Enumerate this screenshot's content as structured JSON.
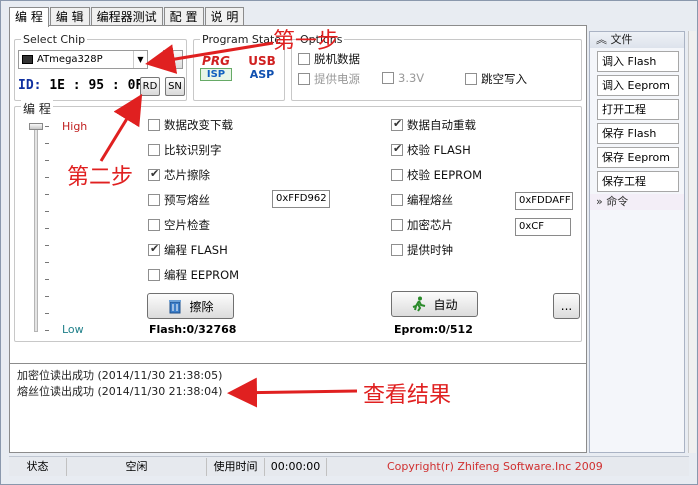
{
  "tabs": [
    "编 程",
    "编 辑",
    "编程器测试",
    "配 置",
    "说 明"
  ],
  "chip": {
    "group_title": "Select Chip",
    "selected": "ATmega328P",
    "id_label": "ID:",
    "id_value": "1E : 95 : 0F",
    "rd_label": "RD",
    "sn_label": "SN"
  },
  "program_state": {
    "group_title": "Program State",
    "prg": "PRG",
    "isp": "ISP",
    "usb": "USB",
    "asp": "ASP"
  },
  "options": {
    "group_title": "Options",
    "offline": "脱机数据",
    "power": "提供电源",
    "voltage": "3.3V",
    "skip": "跳空写入"
  },
  "program_group": {
    "title": "编 程",
    "high": "High",
    "low": "Low",
    "left_checks": [
      {
        "label": "数据改变下载",
        "checked": false
      },
      {
        "label": "比较识别字",
        "checked": false
      },
      {
        "label": "芯片擦除",
        "checked": true
      },
      {
        "label": "预写熔丝",
        "checked": false
      },
      {
        "label": "空片检查",
        "checked": false
      },
      {
        "label": "编程 FLASH",
        "checked": true
      },
      {
        "label": "编程 EEPROM",
        "checked": false
      }
    ],
    "right_checks": [
      {
        "label": "数据自动重载",
        "checked": true
      },
      {
        "label": "校验 FLASH",
        "checked": true
      },
      {
        "label": "校验 EEPROM",
        "checked": false
      },
      {
        "label": "编程熔丝",
        "checked": false
      },
      {
        "label": "加密芯片",
        "checked": false
      },
      {
        "label": "提供时钟",
        "checked": false
      }
    ],
    "prefuse_value": "0xFFD962",
    "fuse_value": "0xFDDAFF",
    "lock_value": "0xCF",
    "erase_button": "擦除",
    "auto_button": "自动",
    "more_button": "...",
    "flash_status": "Flash:0/32768",
    "eprom_status": "Eprom:0/512"
  },
  "log": [
    "加密位读出成功 (2014/11/30 21:38:05)",
    "熔丝位读出成功 (2014/11/30 21:38:04)"
  ],
  "right_panel": {
    "file_header": "文件",
    "buttons": [
      "调入 Flash",
      "调入 Eeprom",
      "打开工程",
      "保存 Flash",
      "保存 Eeprom",
      "保存工程"
    ],
    "cmd_header": "命令"
  },
  "status": {
    "state_label": "状态",
    "state_value": "空闲",
    "time_label": "使用时间",
    "time_value": "00:00:00",
    "copyright": "Copyright(r) Zhifeng Software.Inc 2009"
  },
  "annotations": {
    "step1": "第一步",
    "step2": "第二步",
    "result": "查看结果",
    "colors": {
      "annotation": "#e02020"
    }
  }
}
